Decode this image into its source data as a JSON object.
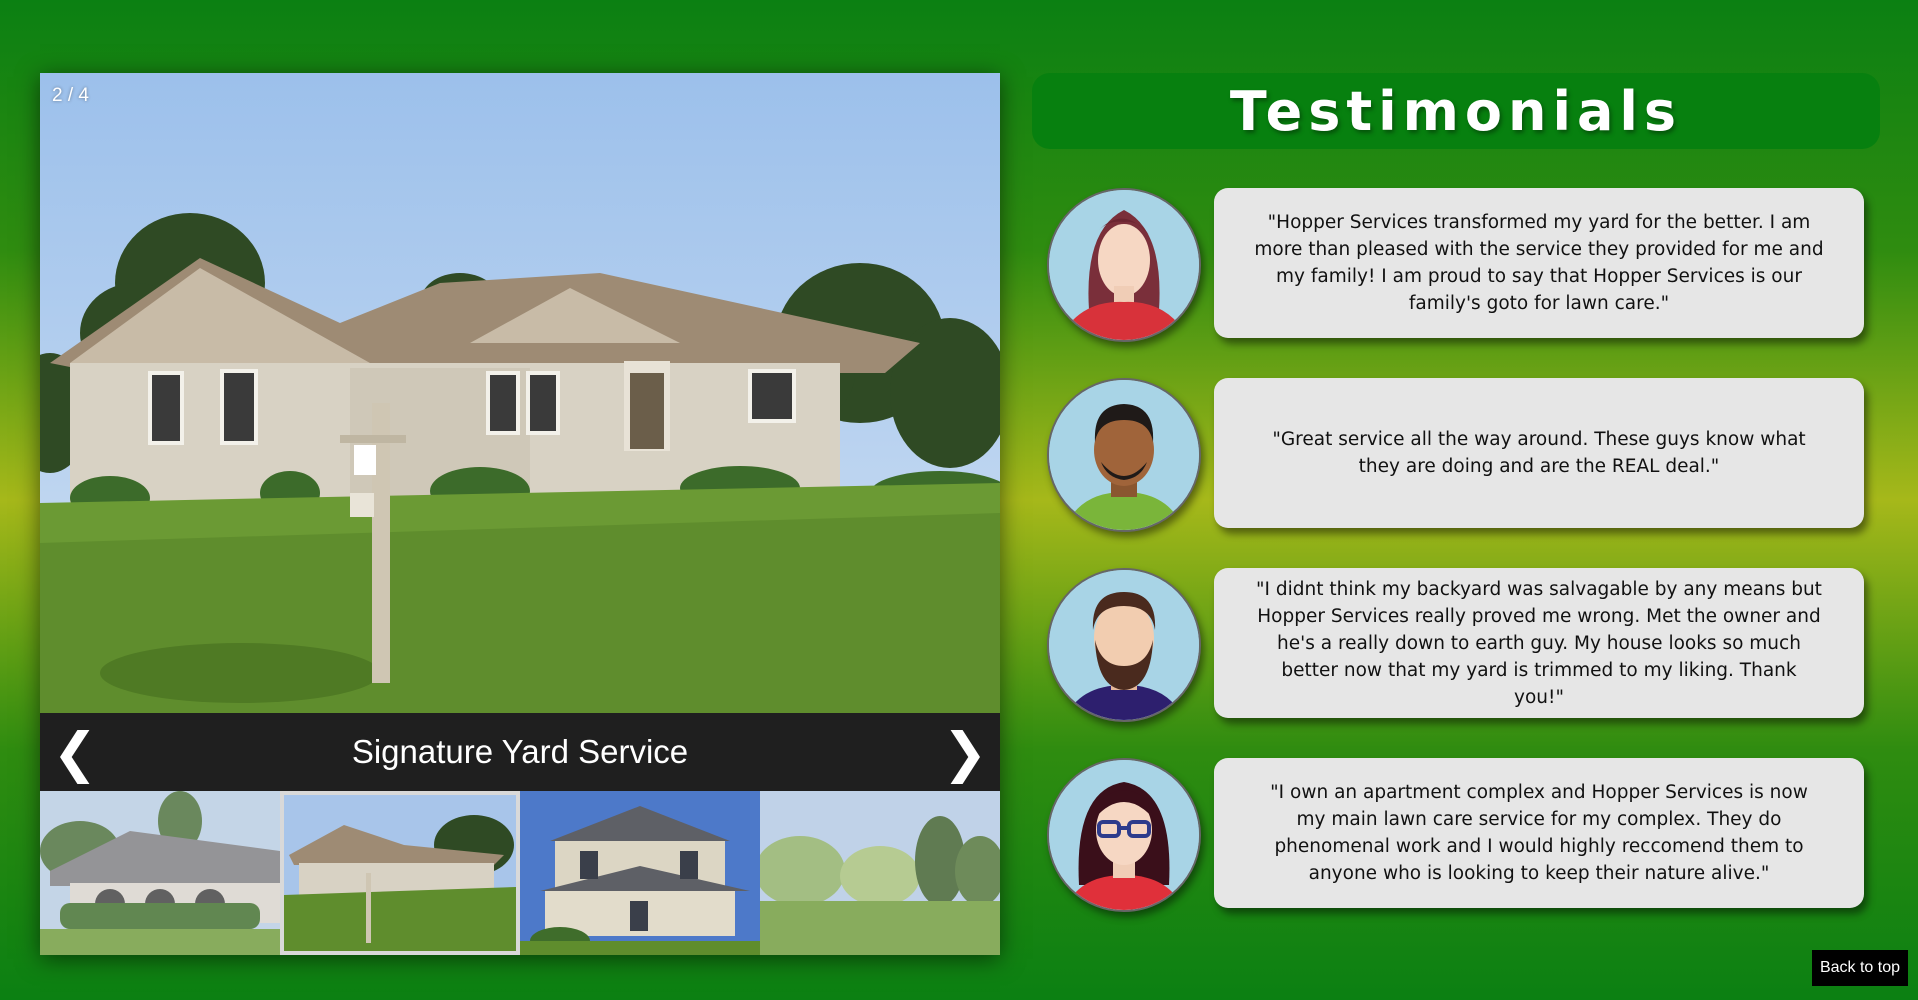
{
  "gallery": {
    "counter": "2 / 4",
    "caption": "Signature Yard Service",
    "prev_icon": "chevron-left-icon",
    "next_icon": "chevron-right-icon",
    "active_thumb_index": 1,
    "thumb_count": 4
  },
  "testimonials": {
    "title": "Testimonials",
    "items": [
      {
        "avatar": "woman-red-hair-avatar",
        "quote": "\"Hopper Services transformed my yard for the better. I am more than pleased with the service they provided for me and my family! I am proud to say that Hopper Services is our family's goto for lawn care.\""
      },
      {
        "avatar": "man-green-shirt-avatar",
        "quote": "\"Great service all the way around. These guys know what they are doing and are the REAL deal.\""
      },
      {
        "avatar": "bearded-man-avatar",
        "quote": "\"I didnt think my backyard was salvagable by any means but Hopper Services really proved me wrong. Met the owner and he's a really down to earth guy. My house looks so much better now that my yard is trimmed to my liking. Thank you!\""
      },
      {
        "avatar": "woman-glasses-avatar",
        "quote": "\"I own an apartment complex and Hopper Services is now my main lawn care service for my complex. They do phenomenal work and I would highly reccomend them to anyone who is looking to keep their nature alive.\""
      }
    ]
  },
  "back_to_top": "Back to top",
  "colors": {
    "title_bar": "#07800f",
    "quote_bg": "#e6e6e6",
    "caption_bar": "#1f1f1f"
  }
}
